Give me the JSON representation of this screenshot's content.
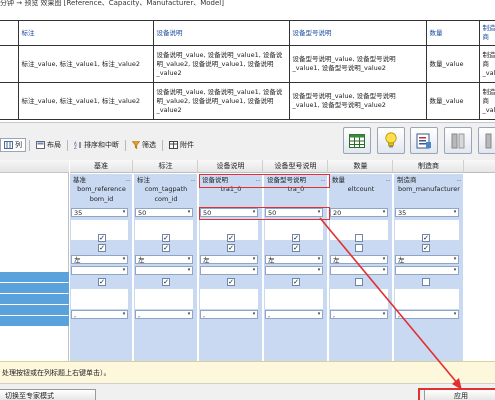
{
  "top_line": "分钟 → 预览 效果图 [Reference、Capacity、Manufacturer、Model]",
  "preview": {
    "headers": [
      "标注",
      "设备说明",
      "设备型号说明",
      "数量",
      "制造商"
    ],
    "rows": [
      {
        "biaozhu": "标注_value, 标注_value1, 标注_value2",
        "shebei": "设备说明_value, 设备说明_value1, 设备说明_value2, 设备说明_value1, 设备说明_value2",
        "xinghao": "设备型号说明_value, 设备型号说明_value1, 设备型号说明_value2",
        "shuliang": "数量_value",
        "zhizao": "制造商_value"
      },
      {
        "biaozhu": "标注_value, 标注_value1, 标注_value2",
        "shebei": "设备说明_value, 设备说明_value1, 设备说明_value2, 设备说明_value1, 设备说明_value2",
        "xinghao": "设备型号说明_value, 设备型号说明_value1, 设备型号说明_value2",
        "shuliang": "数量_value",
        "zhizao": "制造商_value"
      }
    ]
  },
  "tabs": [
    {
      "label": "列",
      "icon": "columns-icon"
    },
    {
      "label": "布局",
      "icon": "layout-icon"
    },
    {
      "label": "排序和中断",
      "icon": "sort-icon"
    },
    {
      "label": "筛选",
      "icon": "filter-icon"
    },
    {
      "label": "附件",
      "icon": "attachment-icon"
    }
  ],
  "grid": {
    "headers": [
      "基准",
      "标注",
      "设备说明",
      "设备型号说明",
      "数量",
      "制造商"
    ],
    "display_names": [
      "基准",
      "标注",
      "设备说明",
      "设备型号说明",
      "数量",
      "制造商"
    ],
    "fields_row1": [
      "bom_reference",
      "com_tagpath",
      "tra1_0",
      "tra_0",
      "eltcount",
      "bom_manufacturer"
    ],
    "fields_row2": [
      "bom_id",
      "com_id"
    ],
    "widths": [
      "35",
      "50",
      "50",
      "50",
      "20",
      "35"
    ],
    "align": [
      "左",
      "左",
      "左",
      "左",
      "左",
      "左"
    ],
    "separator": ","
  },
  "hint": "处理按钮或在列标题上右键单击）。",
  "buttons": {
    "expert": "切换至专家模式",
    "apply": "应用"
  },
  "colors": {
    "accent_red": "#e03030",
    "panel_blue": "#c8d9f1",
    "selection_blue": "#5aa2dc"
  }
}
